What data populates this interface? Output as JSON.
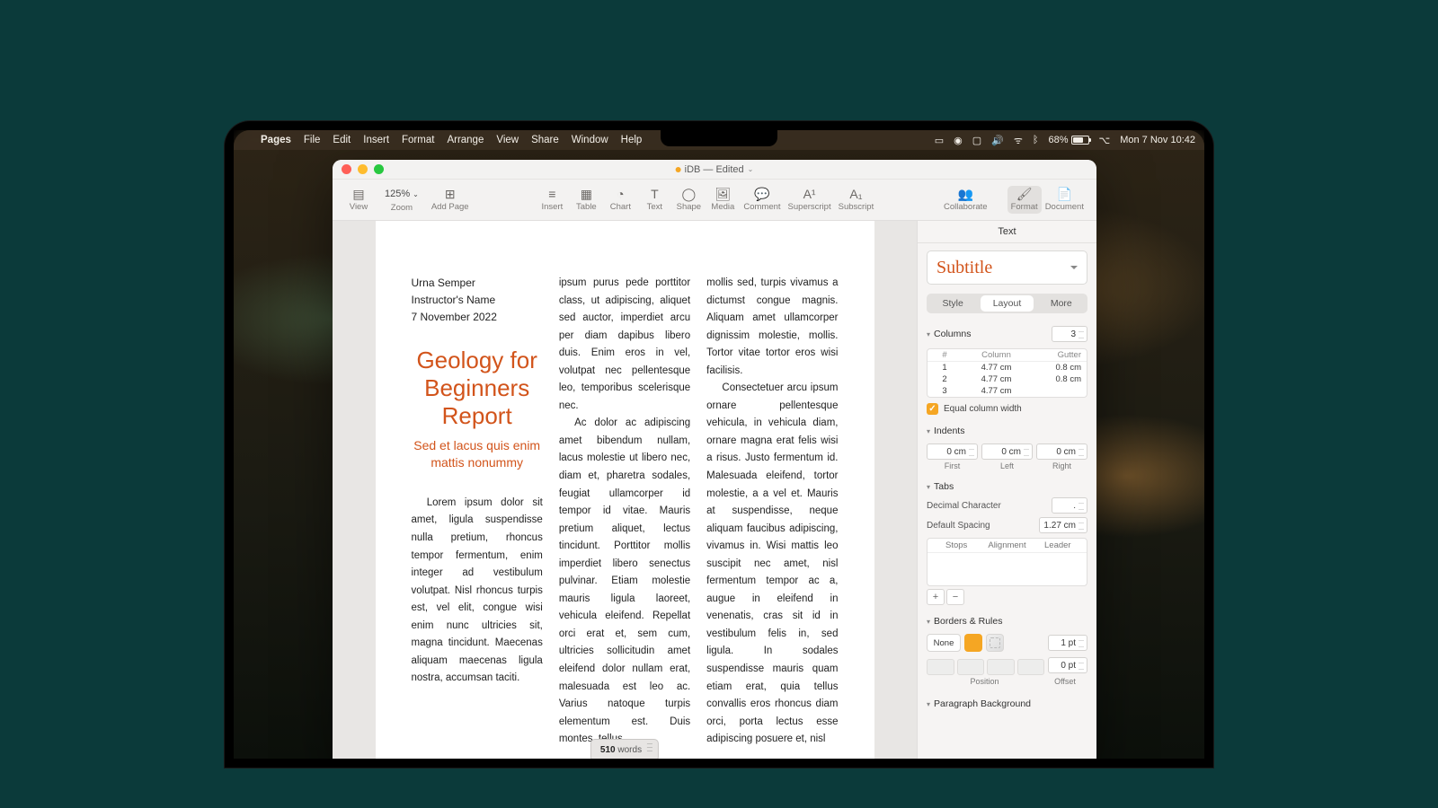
{
  "menubar": {
    "app": "Pages",
    "items": [
      "File",
      "Edit",
      "Insert",
      "Format",
      "Arrange",
      "View",
      "Share",
      "Window",
      "Help"
    ],
    "battery": "68%",
    "clock": "Mon 7 Nov  10:42"
  },
  "window": {
    "title": "iDB — Edited",
    "zoom": "125%",
    "toolbar": {
      "view": "View",
      "zoom": "Zoom",
      "addpage": "Add Page",
      "insert": "Insert",
      "table": "Table",
      "chart": "Chart",
      "text": "Text",
      "shape": "Shape",
      "media": "Media",
      "comment": "Comment",
      "superscript": "Superscript",
      "subscript": "Subscript",
      "collaborate": "Collaborate",
      "format": "Format",
      "document": "Document"
    },
    "wordcount_num": "510",
    "wordcount_unit": "words"
  },
  "document": {
    "meta1": "Urna Semper",
    "meta2": "Instructor's Name",
    "meta3": "7 November 2022",
    "title": "Geology for Beginners Report",
    "subtitle": "Sed et lacus quis enim mattis nonummy",
    "p1": "Lorem ipsum dolor sit amet, ligula suspendisse nulla pretium, rhoncus tempor fermentum, enim integer ad vestibulum volutpat. Nisl rhoncus turpis est, vel elit, congue wisi enim nunc ultricies sit, magna tincidunt. Maecenas aliquam maecenas ligula nostra, accumsan taciti.",
    "p2": "ipsum purus pede porttitor class, ut adipiscing, aliquet sed auctor, imperdiet arcu per diam dapibus libero duis. Enim eros in vel, volutpat nec pellentesque leo, temporibus scelerisque nec.",
    "p3": "Ac dolor ac adipiscing amet bibendum nullam, lacus molestie ut libero nec, diam et, pharetra sodales, feugiat ullamcorper id tempor id vitae. Mauris pretium aliquet, lectus tincidunt. Porttitor mollis imperdiet libero senectus pulvinar. Etiam molestie mauris ligula laoreet, vehicula eleifend. Repellat orci erat et, sem cum, ultricies sollicitudin amet eleifend dolor nullam erat, malesuada est leo ac. Varius natoque turpis elementum est. Duis montes, tellus",
    "p4": "mollis sed, turpis vivamus a dictumst congue magnis. Aliquam amet ullamcorper dignissim molestie, mollis. Tortor vitae tortor eros wisi facilisis.",
    "p5": "Consectetuer arcu ipsum ornare pellentesque vehicula, in vehicula diam, ornare magna erat felis wisi a risus. Justo fermentum id. Malesuada eleifend, tortor molestie, a a vel et. Mauris at suspendisse, neque aliquam faucibus adipiscing, vivamus in. Wisi mattis leo suscipit nec amet, nisl fermentum tempor ac a, augue in eleifend in venenatis, cras sit id in vestibulum felis in, sed ligula. In sodales suspendisse mauris quam etiam erat, quia tellus convallis eros rhoncus diam orci, porta lectus esse adipiscing posuere et, nisl"
  },
  "inspector": {
    "tab": "Text",
    "style": "Subtitle",
    "seg": {
      "style": "Style",
      "layout": "Layout",
      "more": "More"
    },
    "columns": {
      "label": "Columns",
      "count": "3",
      "head": {
        "n": "#",
        "col": "Column",
        "gutter": "Gutter"
      },
      "rows": [
        {
          "n": "1",
          "col": "4.77 cm",
          "gutter": "0.8 cm"
        },
        {
          "n": "2",
          "col": "4.77 cm",
          "gutter": "0.8 cm"
        },
        {
          "n": "3",
          "col": "4.77 cm",
          "gutter": ""
        }
      ],
      "equal": "Equal column width"
    },
    "indents": {
      "label": "Indents",
      "first": "0 cm",
      "left": "0 cm",
      "right": "0 cm",
      "cap_first": "First",
      "cap_left": "Left",
      "cap_right": "Right"
    },
    "tabs": {
      "label": "Tabs",
      "decimal_lbl": "Decimal Character",
      "decimal": ".",
      "spacing_lbl": "Default Spacing",
      "spacing": "1.27 cm",
      "stops": "Stops",
      "align": "Alignment",
      "leader": "Leader"
    },
    "borders": {
      "label": "Borders & Rules",
      "none": "None",
      "pt": "1 pt",
      "off": "0 pt",
      "position": "Position",
      "offset": "Offset"
    },
    "para_bg": "Paragraph Background"
  }
}
